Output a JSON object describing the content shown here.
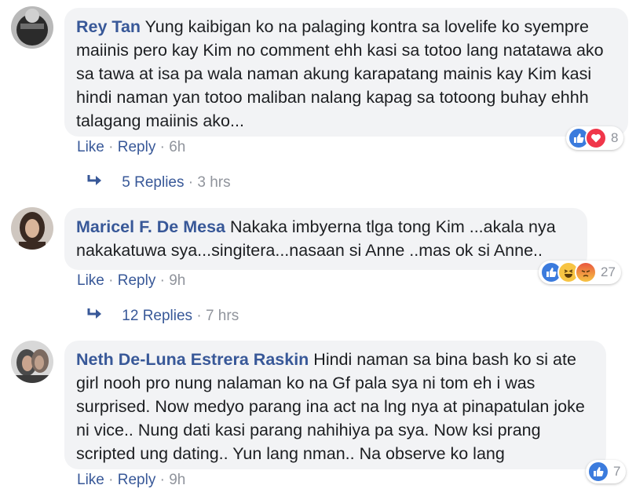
{
  "comments": [
    {
      "author": "Rey Tan",
      "text": "Yung kaibigan ko na palaging kontra sa lovelife ko syempre maiinis pero kay Kim no comment ehh kasi sa totoo lang natatawa ako sa tawa at isa pa wala naman akung karapatang mainis kay Kim kasi hindi naman yan totoo maliban nalang kapag sa totoong buhay ehhh talagang maiinis ako...",
      "like": "Like",
      "reply": "Reply",
      "time": "6h",
      "reaction_icons": [
        "like-icon",
        "love-icon"
      ],
      "reaction_count": "8",
      "replies_label": "5 Replies",
      "replies_time": "3 hrs"
    },
    {
      "author": "Maricel F. De Mesa",
      "text": "Nakaka imbyerna tlga tong Kim ...akala nya nakakatuwa sya...singitera...nasaan si Anne ..mas ok si Anne..",
      "like": "Like",
      "reply": "Reply",
      "time": "9h",
      "reaction_icons": [
        "like-icon",
        "haha-icon",
        "angry-icon"
      ],
      "reaction_count": "27",
      "replies_label": "12 Replies",
      "replies_time": "7 hrs"
    },
    {
      "author": "Neth De-Luna Estrera Raskin",
      "text": "Hindi naman sa bina bash ko si ate girl nooh pro nung nalaman ko na Gf pala sya ni tom eh i was surprised. Now medyo parang ina act na lng nya at pinapatulan joke ni vice.. Nung dati kasi parang nahihiya pa sya. Now ksi prang scripted ung dating.. Yun lang nman.. Na observe ko lang",
      "like": "Like",
      "reply": "Reply",
      "time": "9h",
      "reaction_icons": [
        "like-icon"
      ],
      "reaction_count": "7"
    }
  ],
  "separator": "·",
  "colors": {
    "link": "#385898",
    "muted": "#90949c",
    "bubble": "#f2f3f5",
    "like": "#3b7bdd",
    "love": "#f0364a",
    "haha": "#f7c443",
    "angry": "#e9573f"
  }
}
